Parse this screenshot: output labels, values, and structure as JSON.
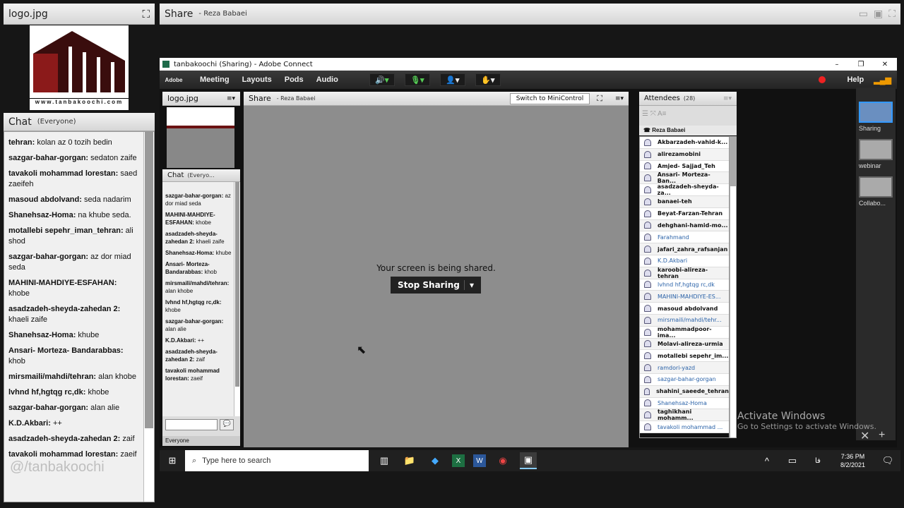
{
  "left_logo_pod": {
    "title": "logo.jpg",
    "logo_text": "www.tanbakoochi.com"
  },
  "left_chat": {
    "title": "Chat",
    "scope": "(Everyone)",
    "messages": [
      {
        "from": "tehran:",
        "text": "kolan az 0 tozih bedin"
      },
      {
        "from": "sazgar-bahar-gorgan:",
        "text": "sedaton zaife"
      },
      {
        "from": "tavakoli mohammad lorestan:",
        "text": "saed zaeifeh"
      },
      {
        "from": "masoud abdolvand:",
        "text": "seda nadarim"
      },
      {
        "from": "Shanehsaz-Homa:",
        "text": "na khube seda."
      },
      {
        "from": "motallebi sepehr_iman_tehran:",
        "text": "ali shod"
      },
      {
        "from": "sazgar-bahar-gorgan:",
        "text": "az dor miad seda"
      },
      {
        "from": "MAHINI-MAHDIYE-ESFAHAN:",
        "text": "khobe"
      },
      {
        "from": "asadzadeh-sheyda-zahedan 2:",
        "text": "khaeli zaife"
      },
      {
        "from": "Shanehsaz-Homa:",
        "text": "khube"
      },
      {
        "from": "Ansari- Morteza- Bandarabbas:",
        "text": "khob"
      },
      {
        "from": "mirsmaili/mahdi/tehran:",
        "text": "alan khobe"
      },
      {
        "from": "lvhnd hf,hgtqg rc,dk:",
        "text": "khobe"
      },
      {
        "from": "sazgar-bahar-gorgan:",
        "text": "alan alie"
      },
      {
        "from": "K.D.Akbari:",
        "text": "++"
      },
      {
        "from": "asadzadeh-sheyda-zahedan 2:",
        "text": "zaif"
      },
      {
        "from": "tavakoli mohammad lorestan:",
        "text": "zaeif"
      }
    ],
    "watermark": "@/tanbakoochi"
  },
  "share_pod": {
    "title": "Share",
    "presenter": "- Reza Babaei"
  },
  "window": {
    "title": "tanbakoochi (Sharing) - Adobe Connect",
    "menu": [
      "Meeting",
      "Layouts",
      "Pods",
      "Audio"
    ],
    "help": "Help",
    "adobe": "Adobe",
    "inner_logo_title": "logo.jpg",
    "inner_chat": {
      "title": "Chat",
      "scope": "(Everyo...",
      "footer": "Everyone",
      "messages": [
        {
          "from": "sazgar-bahar-gorgan:",
          "text": "az dor miad seda"
        },
        {
          "from": "MAHINI-MAHDIYE-ESFAHAN:",
          "text": "khobe"
        },
        {
          "from": "asadzadeh-sheyda-zahedan 2:",
          "text": "khaeli zaife"
        },
        {
          "from": "Shanehsaz-Homa:",
          "text": "khube"
        },
        {
          "from": "Ansari- Morteza-Bandarabbas:",
          "text": "khob"
        },
        {
          "from": "mirsmaili/mahdi/tehran:",
          "text": "alan khobe"
        },
        {
          "from": "lvhnd hf,hgtqg rc,dk:",
          "text": "khobe"
        },
        {
          "from": "sazgar-bahar-gorgan:",
          "text": "alan alie"
        },
        {
          "from": "K.D.Akbari:",
          "text": "++"
        },
        {
          "from": "asadzadeh-sheyda-zahedan 2:",
          "text": "zaif"
        },
        {
          "from": "tavakoli mohammad lorestan:",
          "text": "zaeif"
        }
      ]
    },
    "share": {
      "title": "Share",
      "presenter": "- Reza Babaei",
      "mini": "Switch to MiniControl",
      "status": "Your screen is being shared.",
      "stop": "Stop Sharing"
    },
    "attendees": {
      "title": "Attendees",
      "count": "(28)",
      "host": "Reza Babaei",
      "list": [
        {
          "n": "Akbarzadeh-vahid-k...",
          "b": false
        },
        {
          "n": "alirezamobini",
          "b": false
        },
        {
          "n": "Amjed- Sajjad_Teh",
          "b": false
        },
        {
          "n": "Ansari- Morteza- Ban...",
          "b": false
        },
        {
          "n": "asadzadeh-sheyda-za...",
          "b": false
        },
        {
          "n": "banaei-teh",
          "b": false
        },
        {
          "n": "Beyat-Farzan-Tehran",
          "b": false
        },
        {
          "n": "dehghani-hamid-mo...",
          "b": false
        },
        {
          "n": "Farahmand",
          "b": true
        },
        {
          "n": "jafari_zahra_rafsanjan",
          "b": false
        },
        {
          "n": "K.D.Akbari",
          "b": true
        },
        {
          "n": "karoobi-alireza-tehran",
          "b": false
        },
        {
          "n": "lvhnd hf,hgtqg rc,dk",
          "b": true
        },
        {
          "n": "MAHINI-MAHDIYE-ES...",
          "b": true
        },
        {
          "n": "masoud abdolvand",
          "b": false
        },
        {
          "n": "mirsmaili/mahdi/tehr...",
          "b": true
        },
        {
          "n": "mohammadpoor-ima...",
          "b": false
        },
        {
          "n": "Molavi-alireza-urmia",
          "b": false
        },
        {
          "n": "motallebi sepehr_im...",
          "b": false
        },
        {
          "n": "ramdori-yazd",
          "b": true
        },
        {
          "n": "sazgar-bahar-gorgan",
          "b": true
        },
        {
          "n": "shahini_saeede_tehran",
          "b": false
        },
        {
          "n": "Shanehsaz-Homa",
          "b": true
        },
        {
          "n": "taghikhani mohamm...",
          "b": false
        },
        {
          "n": "tavakoli mohammad ...",
          "b": true
        }
      ]
    },
    "layouts": [
      "Sharing",
      "webinar",
      "Collabo..."
    ]
  },
  "activation": {
    "title": "Activate Windows",
    "sub": "Go to Settings to activate Windows."
  },
  "taskbar": {
    "search_placeholder": "Type here to search",
    "time": "7:36 PM",
    "date": "8/2/2021",
    "lang": "فا"
  }
}
